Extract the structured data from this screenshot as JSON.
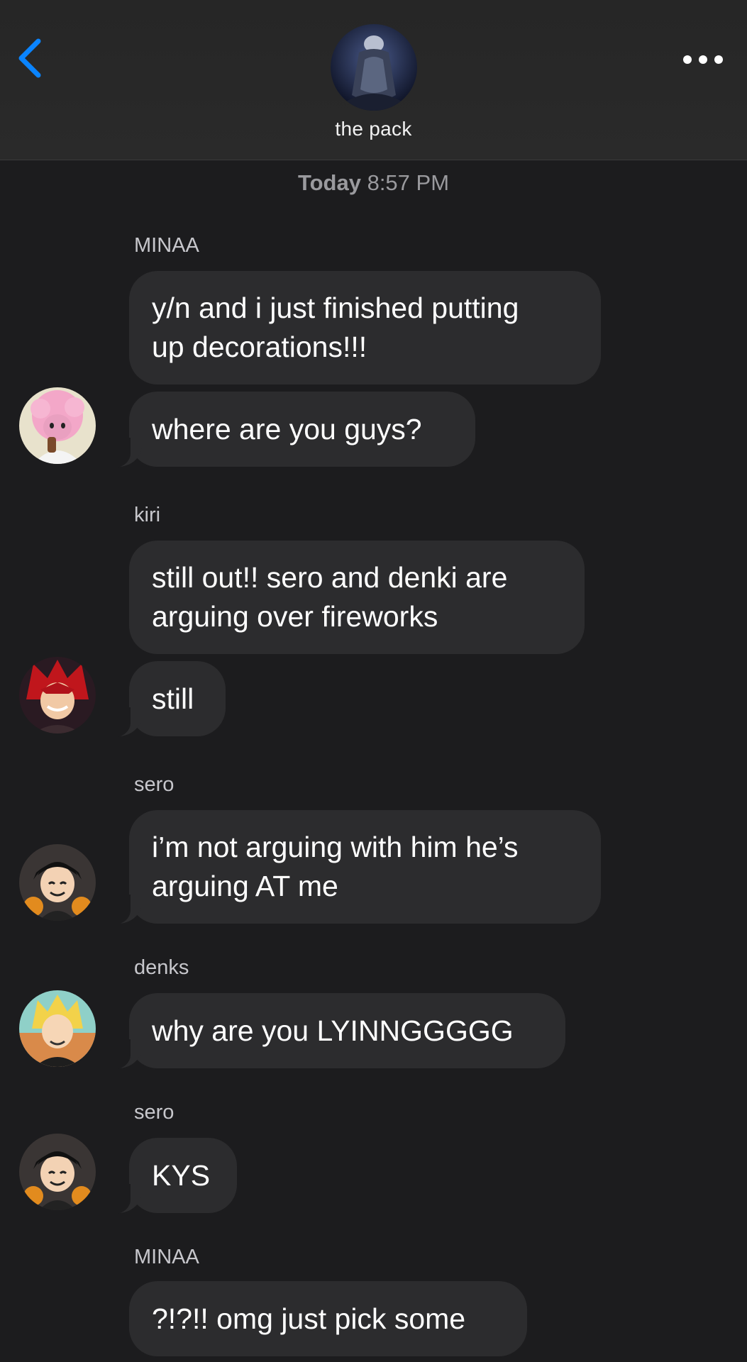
{
  "header": {
    "group_name": "the pack"
  },
  "icons": {
    "back": "chevron-left-icon",
    "more": "more-horizontal-icon"
  },
  "colors": {
    "accent": "#0a84ff",
    "background": "#1c1c1e",
    "bubble": "#2c2c2e"
  },
  "timestamp": {
    "day": "Today",
    "time": "8:57 PM"
  },
  "messages": [
    {
      "sender": "MINAA",
      "text": "y/n and i just finished putting\nup decorations!!!"
    },
    {
      "text": "where are you guys?"
    },
    {
      "sender": "kiri",
      "text": "still out!! sero and denki are\narguing over fireworks"
    },
    {
      "text": "still"
    },
    {
      "sender": "sero",
      "text": "i’m not arguing with him he’s\narguing AT me"
    },
    {
      "sender": "denks",
      "text": "why are you LYINNGGGGG"
    },
    {
      "sender": "sero",
      "text": "KYS"
    },
    {
      "sender": "MINAA",
      "text": "?!?!! omg just pick some"
    }
  ]
}
